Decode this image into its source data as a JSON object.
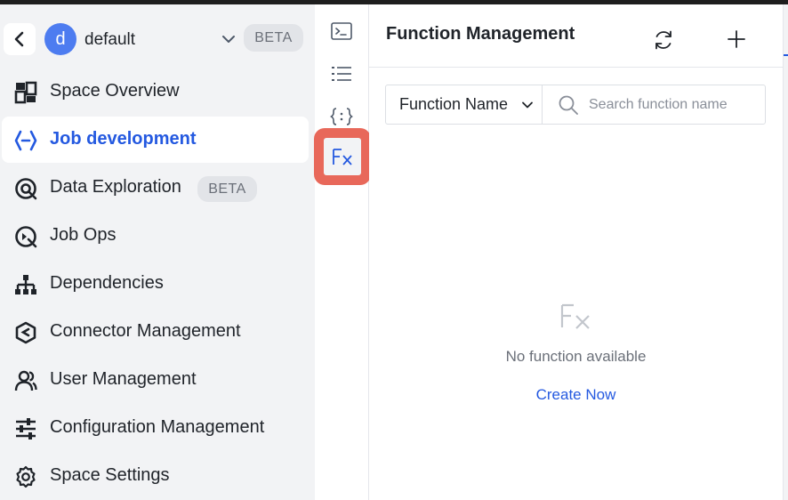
{
  "space": {
    "avatar_letter": "d",
    "name": "default",
    "beta": "BETA"
  },
  "nav": {
    "items": [
      {
        "label": "Space Overview",
        "icon": "grid-icon"
      },
      {
        "label": "Job development",
        "icon": "code-icon",
        "active": true
      },
      {
        "label": "Data Exploration",
        "icon": "at-search-icon",
        "badge": "BETA"
      },
      {
        "label": "Job Ops",
        "icon": "ops-icon"
      },
      {
        "label": "Dependencies",
        "icon": "hierarchy-icon"
      },
      {
        "label": "Connector Management",
        "icon": "hexagon-icon"
      },
      {
        "label": "User Management",
        "icon": "users-icon"
      },
      {
        "label": "Configuration Management",
        "icon": "sliders-icon"
      },
      {
        "label": "Space Settings",
        "icon": "gear-icon"
      }
    ]
  },
  "rail": {
    "items": [
      "terminal-icon",
      "list-icon",
      "json-braces-icon",
      "function-fx-icon"
    ],
    "active": "function-fx-icon"
  },
  "panel": {
    "title": "Function Management",
    "filter_select": "Function Name",
    "search_placeholder": "Search function name",
    "empty_text": "No function available",
    "create_link": "Create Now"
  },
  "colors": {
    "accent": "#2459e0",
    "highlight": "#e8685a",
    "sidebar_bg": "#f2f3f5",
    "avatar": "#4d7cf0"
  }
}
